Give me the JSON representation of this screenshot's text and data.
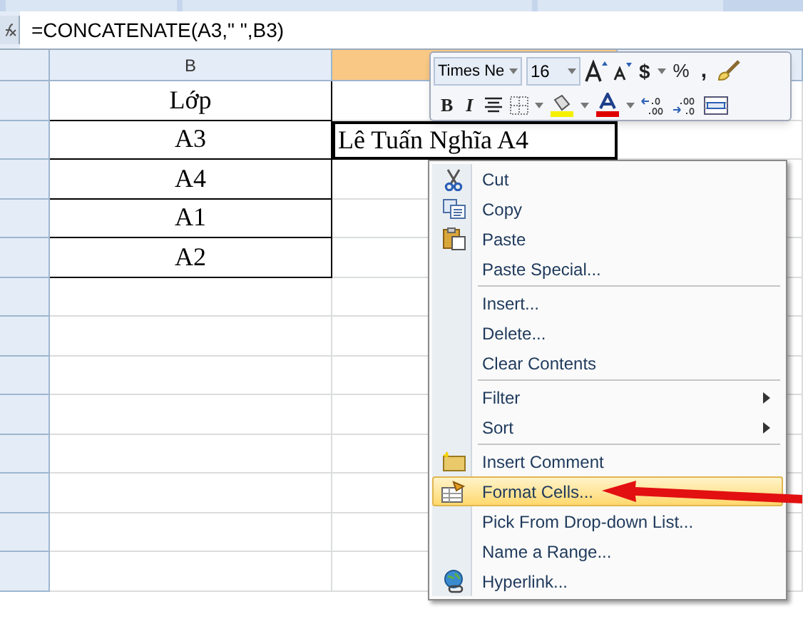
{
  "formula_bar": {
    "formula": "=CONCATENATE(A3,\" \",B3)"
  },
  "columns": [
    {
      "selected": false
    },
    {
      "label": "B",
      "selected": false
    },
    {
      "selected": true
    },
    {
      "selected": false
    }
  ],
  "rows": [
    {
      "cells": [
        "",
        "Lớp",
        "",
        ""
      ]
    },
    {
      "cells": [
        "",
        "A3",
        "Lê Tuấn Nghĩa A4",
        ""
      ]
    },
    {
      "cells": [
        "",
        "A4",
        "",
        ""
      ]
    },
    {
      "cells": [
        "",
        "A1",
        "",
        ""
      ]
    },
    {
      "cells": [
        "",
        "A2",
        "",
        ""
      ]
    },
    {
      "cells": [
        "",
        "",
        "",
        ""
      ]
    },
    {
      "cells": [
        "",
        "",
        "",
        ""
      ]
    },
    {
      "cells": [
        "",
        "",
        "",
        ""
      ]
    },
    {
      "cells": [
        "",
        "",
        "",
        ""
      ]
    },
    {
      "cells": [
        "",
        "",
        "",
        ""
      ]
    },
    {
      "cells": [
        "",
        "",
        "",
        ""
      ]
    },
    {
      "cells": [
        "",
        "",
        "",
        ""
      ]
    },
    {
      "cells": [
        "",
        "",
        "",
        ""
      ]
    }
  ],
  "mini_toolbar": {
    "font": "Times Ne",
    "size": "16",
    "currency": "$",
    "percent": "%",
    "comma": ",",
    "bold": "B",
    "italic": "I"
  },
  "context_menu": [
    {
      "kind": "item",
      "label": "Cut",
      "submenu": false,
      "selected": false
    },
    {
      "kind": "item",
      "label": "Copy",
      "submenu": false,
      "selected": false
    },
    {
      "kind": "item",
      "label": "Paste",
      "submenu": false,
      "selected": false
    },
    {
      "kind": "item",
      "label": "Paste Special...",
      "submenu": false,
      "selected": false
    },
    {
      "kind": "separator"
    },
    {
      "kind": "item",
      "label": "Insert...",
      "submenu": false,
      "selected": false
    },
    {
      "kind": "item",
      "label": "Delete...",
      "submenu": false,
      "selected": false
    },
    {
      "kind": "item",
      "label": "Clear Contents",
      "submenu": false,
      "selected": false
    },
    {
      "kind": "separator"
    },
    {
      "kind": "item",
      "label": "Filter",
      "submenu": true,
      "selected": false
    },
    {
      "kind": "item",
      "label": "Sort",
      "submenu": true,
      "selected": false
    },
    {
      "kind": "separator"
    },
    {
      "kind": "item",
      "label": "Insert Comment",
      "submenu": false,
      "selected": false
    },
    {
      "kind": "item",
      "label": "Format Cells...",
      "submenu": false,
      "selected": true
    },
    {
      "kind": "item",
      "label": "Pick From Drop-down List...",
      "submenu": false,
      "selected": false
    },
    {
      "kind": "item",
      "label": "Name a Range...",
      "submenu": false,
      "selected": false
    },
    {
      "kind": "item",
      "label": "Hyperlink...",
      "submenu": false,
      "selected": false
    }
  ]
}
